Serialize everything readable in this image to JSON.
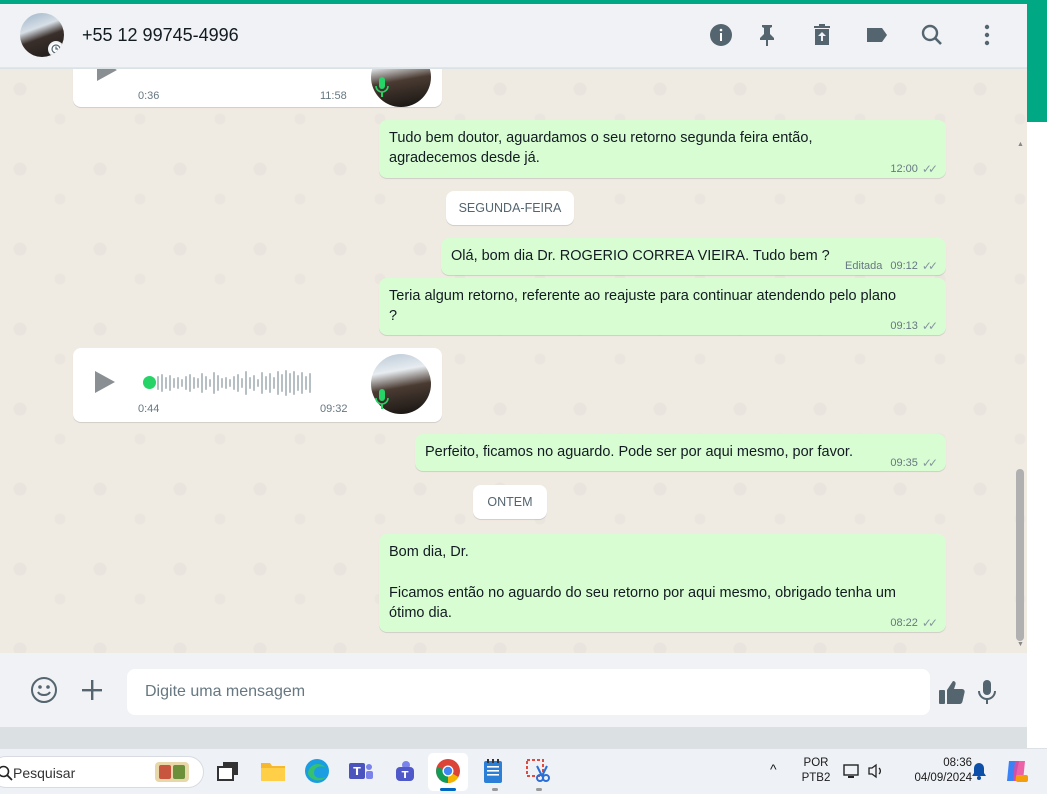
{
  "header": {
    "contact_name": "+55 12 99745-4996",
    "icons": [
      "info-icon",
      "pin-icon",
      "delete-icon",
      "label-icon",
      "search-icon",
      "menu-icon"
    ]
  },
  "messages": {
    "audio1": {
      "duration": "0:36",
      "time": "11:58"
    },
    "m1": {
      "line1": "Tudo bem doutor, aguardamos o seu retorno segunda feira então,",
      "line2": "agradecemos desde já.",
      "time": "12:00"
    },
    "day1": "SEGUNDA-FEIRA",
    "m2": {
      "text": "Olá, bom dia Dr. ROGERIO CORREA VIEIRA. Tudo bem ?",
      "edited": "Editada",
      "time": "09:12"
    },
    "m3": {
      "line1": "Teria algum retorno, referente ao reajuste para continuar atendendo pelo plano",
      "line2": "?",
      "time": "09:13"
    },
    "audio2": {
      "duration": "0:44",
      "time": "09:32"
    },
    "m4": {
      "text": "Perfeito, ficamos no aguardo. Pode ser por aqui mesmo, por favor.",
      "time": "09:35"
    },
    "day2": "ONTEM",
    "m5": {
      "line1": "Bom dia, Dr.",
      "line2": "Ficamos então no aguardo do seu retorno por aqui mesmo, obrigado tenha um",
      "line3": "ótimo dia.",
      "time": "08:22"
    }
  },
  "composer": {
    "placeholder": "Digite uma mensagem"
  },
  "taskbar": {
    "search_label": "Pesquisar",
    "lang_top": "POR",
    "lang_bottom": "PTB2",
    "clock_time": "08:36",
    "clock_date": "04/09/2024"
  },
  "colors": {
    "accent": "#00a884",
    "outgoing_bubble": "#d9fdd3",
    "chat_bg": "#efeae2",
    "audio_dot": "#25d366"
  }
}
